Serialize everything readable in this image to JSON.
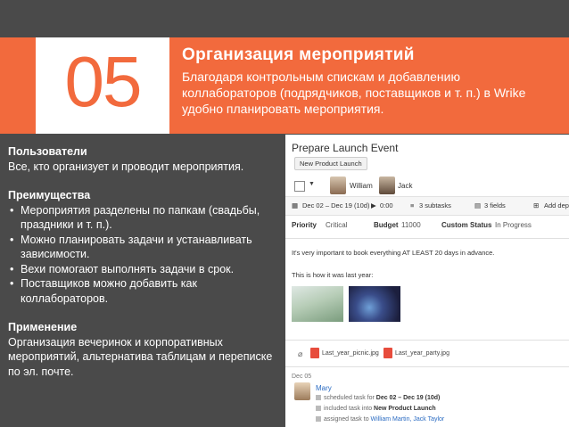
{
  "slide": {
    "number": "05",
    "title": "Организация мероприятий",
    "description": "Благодаря контрольным спискам и добавлению коллабораторов (подрядчиков, поставщиков и т. п.) в Wrike удобно планировать мероприятия.",
    "users_heading": "Пользователи",
    "users_text": "Все, кто организует и проводит мероприятия.",
    "benefits_heading": "Преимущества",
    "benefits": [
      "Мероприятия разделены по папкам (свадьбы, праздники и т. п.).",
      "Можно планировать задачи и устанавливать зависимости.",
      "Вехи помогают выполнять задачи в срок.",
      "Поставщиков можно добавить как коллабораторов."
    ],
    "usage_heading": "Применение",
    "usage_text": "Организация вечеринок и корпоративных мероприятий, альтернатива таблицам и переписке по эл. почте."
  },
  "app": {
    "task_title": "Prepare Launch Event",
    "folder_chip": "New Product Launch",
    "assignees": [
      "William",
      "Jack"
    ],
    "dates": "Dec 02 – Dec 19 (10d)",
    "duration": "0:00",
    "subtasks": "3 subtasks",
    "fields": "3 fields",
    "add_dep": "Add depe",
    "priority_label": "Priority",
    "priority_value": "Critical",
    "budget_label": "Budget",
    "budget_value": "11000",
    "status_label": "Custom Status",
    "status_value": "In Progress",
    "desc_line1": "It's very important to book everything AT LEAST 20 days in advance.",
    "desc_line2": "This is how it was last year:",
    "attachments": [
      "Last_year_picnic.jpg",
      "Last_year_party.jpg"
    ],
    "activity_date": "Dec 05",
    "activity_user": "Mary",
    "activity_1_pre": "scheduled task for",
    "activity_1_val": "Dec 02 – Dec 19 (10d)",
    "activity_2_pre": "included task into",
    "activity_2_val": "New Product Launch",
    "activity_3_pre": "assigned task to",
    "activity_3_val": "William Martin, Jack Taylor"
  },
  "colors": {
    "accent": "#f26a3d",
    "background": "#4a4a4a",
    "link": "#2a6bc2"
  }
}
